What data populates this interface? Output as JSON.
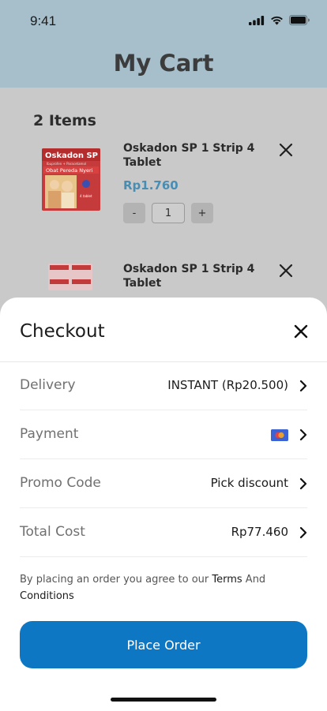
{
  "status_bar": {
    "time": "9:41"
  },
  "header": {
    "title": "My Cart"
  },
  "cart": {
    "items_count": "2 Items",
    "items": [
      {
        "name": "Oskadon SP 1 Strip 4 Tablet",
        "price": "Rp1.760",
        "quantity": "1",
        "decrement_label": "-",
        "increment_label": "+",
        "package_brand": "Oskadon SP",
        "package_subtitle": "Ibuprofen + Paracetamol",
        "package_tagline": "Obat Pereda Nyeri",
        "package_count": "4 tablet"
      },
      {
        "name": "Oskadon SP 1 Strip 4 Tablet"
      }
    ]
  },
  "checkout": {
    "title": "Checkout",
    "rows": [
      {
        "label": "Delivery",
        "value": "INSTANT (Rp20.500)"
      },
      {
        "label": "Payment",
        "value": "",
        "icon": "credit-card-icon"
      },
      {
        "label": "Promo Code",
        "value": "Pick discount"
      },
      {
        "label": "Total Cost",
        "value": "Rp77.460"
      }
    ],
    "agreement": {
      "prefix": "By placing an order you agree to our ",
      "terms": "Terms",
      "middle": " And ",
      "conditions": "Conditions"
    },
    "place_order_label": "Place Order"
  },
  "colors": {
    "header_bg": "#a6bfcb",
    "price": "#4a8db2",
    "primary_button": "#0e77c4",
    "card_blue": "#3b63d6",
    "card_red": "#e94141",
    "card_orange": "#f5a623"
  }
}
